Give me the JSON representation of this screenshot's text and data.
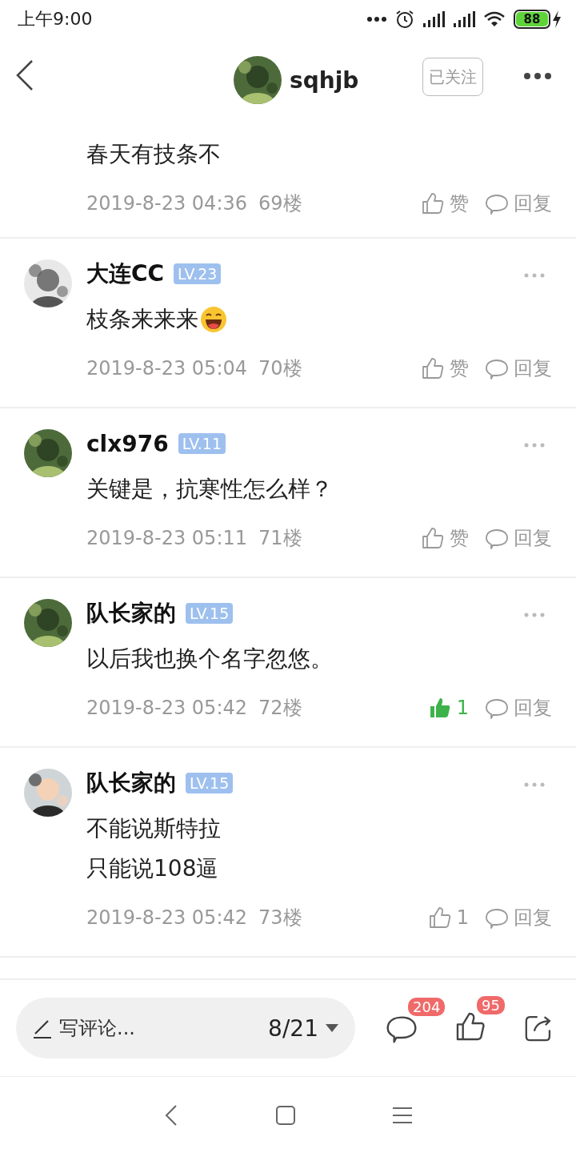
{
  "status_bar": {
    "time": "上午9:00",
    "battery": "88"
  },
  "header": {
    "username": "sqhjb",
    "follow_label": "已关注"
  },
  "posts": [
    {
      "lines": [
        "春天有技条不"
      ],
      "emoji": false,
      "time": "2019-8-23 04:36",
      "floor": "69楼",
      "like": {
        "label": "赞",
        "liked": false
      },
      "reply": "回复"
    },
    {
      "name": "大连CC",
      "level": "LV.23",
      "lines": [
        "枝条来来来"
      ],
      "emoji": true,
      "time": "2019-8-23 05:04",
      "floor": "70楼",
      "like": {
        "label": "赞",
        "liked": false
      },
      "reply": "回复"
    },
    {
      "name": "clx976",
      "level": "LV.11",
      "lines": [
        "关键是，抗寒性怎么样？"
      ],
      "emoji": false,
      "time": "2019-8-23 05:11",
      "floor": "71楼",
      "like": {
        "label": "赞",
        "liked": false
      },
      "reply": "回复"
    },
    {
      "name": "队长家的",
      "level": "LV.15",
      "lines": [
        "以后我也换个名字忽悠。"
      ],
      "emoji": false,
      "time": "2019-8-23 05:42",
      "floor": "72楼",
      "like": {
        "label": "1",
        "liked": true
      },
      "reply": "回复"
    },
    {
      "name": "队长家的",
      "level": "LV.15",
      "lines": [
        "不能说斯特拉",
        "只能说108逼"
      ],
      "emoji": false,
      "time": "2019-8-23 05:42",
      "floor": "73楼",
      "like": {
        "label": "1",
        "liked": false
      },
      "reply": "回复"
    }
  ],
  "bottom_bar": {
    "placeholder": "写评论...",
    "page": "8/21",
    "comment_count": "204",
    "like_count": "95"
  }
}
